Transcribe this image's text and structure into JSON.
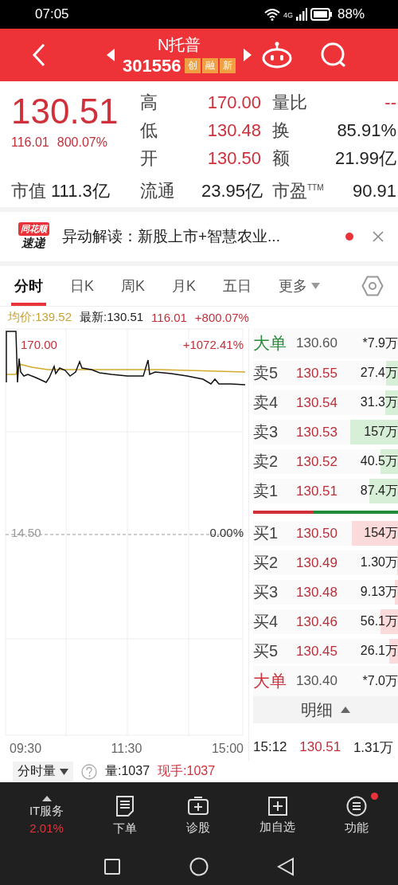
{
  "status_bar": {
    "time": "07:05",
    "network": "4G",
    "battery": "88%"
  },
  "header": {
    "title": "N托普",
    "code": "301556",
    "tags": [
      "创",
      "融",
      "新"
    ]
  },
  "quote": {
    "price": "130.51",
    "change": "116.01",
    "change_pct": "800.07%",
    "stats": [
      {
        "label": "高",
        "value": "170.00",
        "rising": true
      },
      {
        "label": "量比",
        "value": "--",
        "rising": true
      },
      {
        "label": "低",
        "value": "130.48",
        "rising": true
      },
      {
        "label": "换",
        "value": "85.91%",
        "rising": false
      },
      {
        "label": "开",
        "value": "130.50",
        "rising": true
      },
      {
        "label": "额",
        "value": "21.99亿",
        "rising": false
      }
    ],
    "summary": [
      {
        "label": "市值",
        "value": "111.3亿"
      },
      {
        "label": "流通",
        "value": "23.95亿"
      },
      {
        "label": "市盈$^{TTM}$",
        "value": "90.91"
      }
    ]
  },
  "news": {
    "logo": [
      "同花顺",
      "速递"
    ],
    "text": "异动解读：新股上市+智慧农业...",
    "unread": true
  },
  "tabs": [
    {
      "label": "分时",
      "selected": true,
      "dropdown": false
    },
    {
      "label": "日K",
      "selected": false,
      "dropdown": false
    },
    {
      "label": "周K",
      "selected": false,
      "dropdown": false
    },
    {
      "label": "月K",
      "selected": false,
      "dropdown": false
    },
    {
      "label": "五日",
      "selected": false,
      "dropdown": false
    },
    {
      "label": "更多",
      "selected": false,
      "dropdown": true
    }
  ],
  "info": [
    {
      "text": "均价:139.52",
      "kind": "avg"
    },
    {
      "text": "最新:130.51",
      "kind": "latest"
    },
    {
      "text": "116.01",
      "kind": "change"
    },
    {
      "text": "+800.07%",
      "kind": "change"
    }
  ],
  "chart": {
    "top_price": "170.00",
    "top_pct": "+1072.41%",
    "mid_price": "14.50",
    "mid_pct": "0.00%",
    "times": [
      "09:30",
      "11:30",
      "15:00"
    ]
  },
  "order_book": {
    "rows": [
      {
        "label": "大单",
        "price": "130.60",
        "volume": "*7.9万",
        "kind": "big_sell"
      },
      {
        "label": "卖5",
        "price": "130.55",
        "volume": "27.4万",
        "kind": "sell",
        "level": 0.08
      },
      {
        "label": "卖4",
        "price": "130.54",
        "volume": "31.3万",
        "kind": "sell",
        "level": 0.09
      },
      {
        "label": "卖3",
        "price": "130.53",
        "volume": "157万",
        "kind": "sell",
        "level": 0.33
      },
      {
        "label": "卖2",
        "price": "130.52",
        "volume": "40.5万",
        "kind": "sell",
        "level": 0.12
      },
      {
        "label": "卖1",
        "price": "130.51",
        "volume": "87.4万",
        "kind": "sell",
        "level": 0.2
      },
      {
        "kind": "balance",
        "level": 0.41
      },
      {
        "label": "买1",
        "price": "130.50",
        "volume": "154万",
        "kind": "buy",
        "level": 0.32
      },
      {
        "label": "买2",
        "price": "130.49",
        "volume": "1.30万",
        "kind": "buy",
        "level": 0
      },
      {
        "label": "买3",
        "price": "130.48",
        "volume": "9.13万",
        "kind": "buy",
        "level": 0.02
      },
      {
        "label": "买4",
        "price": "130.46",
        "volume": "56.1万",
        "kind": "buy",
        "level": 0.12
      },
      {
        "label": "买5",
        "price": "130.45",
        "volume": "26.1万",
        "kind": "buy",
        "level": 0.06
      },
      {
        "label": "大单",
        "price": "130.40",
        "volume": "*7.0万",
        "kind": "big_buy"
      }
    ],
    "detail_toggle": {
      "label": "明细",
      "expanded": false
    },
    "trades": [
      {
        "time": "15:12",
        "price": "130.51",
        "volume": "1.31万"
      }
    ]
  },
  "volume_bar": {
    "selector": "分时量",
    "volume": "量:1037",
    "current": "现手:1037"
  },
  "bottom_nav": {
    "sector": {
      "label": "IT服务",
      "change": "2.01%"
    },
    "actions": [
      {
        "label": "下单",
        "kind": "order",
        "badge": false
      },
      {
        "label": "诊股",
        "kind": "diagnose",
        "badge": false
      },
      {
        "label": "加自选",
        "kind": "add",
        "badge": false
      },
      {
        "label": "功能",
        "kind": "menu",
        "badge": true
      }
    ]
  }
}
